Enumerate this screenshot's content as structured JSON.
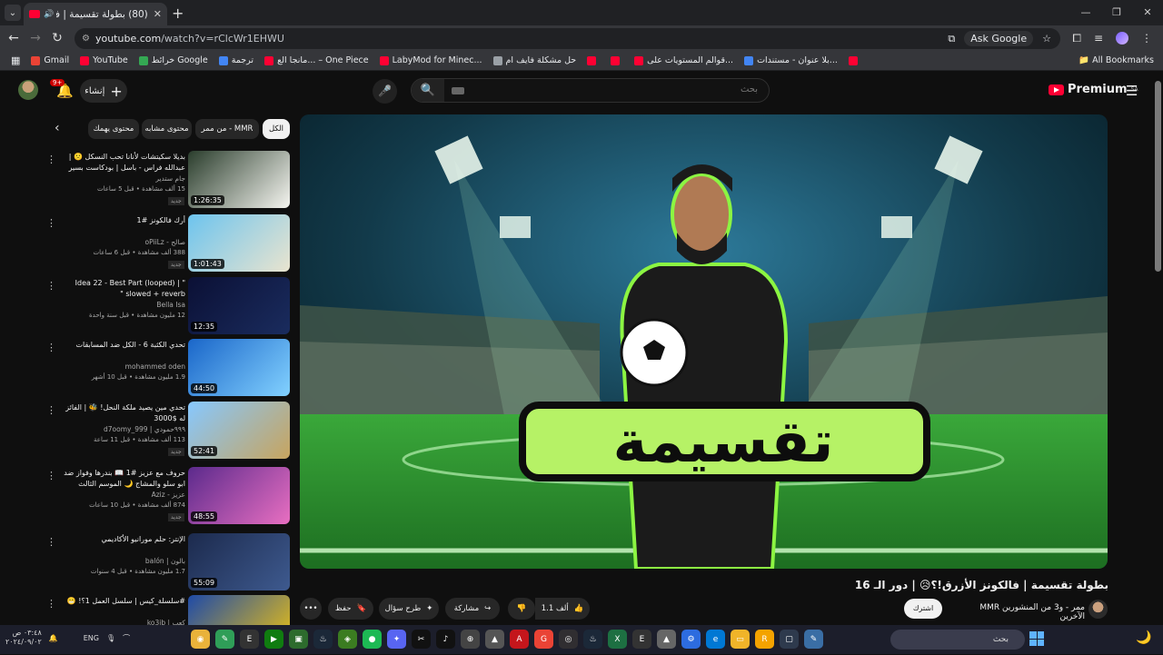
{
  "browser": {
    "tab_title": "(80) بطولة تقسيمة | فالكونز الأ...",
    "url_host": "youtube.com",
    "url_path": "/watch?v=rClcWr1EHWU",
    "ask_google": "Ask Google",
    "bookmarks": [
      {
        "label": "Gmail",
        "color": "#ea4335"
      },
      {
        "label": "YouTube",
        "color": "#ff0033"
      },
      {
        "label": "خرائط Google",
        "color": "#34a853"
      },
      {
        "label": "ترجمة",
        "color": "#4285f4"
      },
      {
        "label": "مانجا الع... – One Piece",
        "color": "#ff0033"
      },
      {
        "label": "LabyMod for Minec...",
        "color": "#ff0033"
      },
      {
        "label": "حل مشكلة فايف ام",
        "color": "#9aa0a6"
      },
      {
        "label": "",
        "color": "#ff0033"
      },
      {
        "label": "",
        "color": "#ff0033"
      },
      {
        "label": "قوالم المستويات على...",
        "color": "#ff0033"
      },
      {
        "label": "بلا عنوان - مستندات...",
        "color": "#4285f4"
      },
      {
        "label": "",
        "color": "#ff0033"
      }
    ],
    "all_bookmarks": "All Bookmarks"
  },
  "header": {
    "create_label": "إنشاء",
    "notif_count": "9+",
    "search_placeholder": "بحث",
    "logo_text": "Premium",
    "logo_region": "SA"
  },
  "chips": [
    {
      "label": "الكل",
      "active": true
    },
    {
      "label": "من ممر - MMR",
      "active": false
    },
    {
      "label": "محتوى مشابه",
      "active": false
    },
    {
      "label": "محتوى يهمك",
      "active": false
    }
  ],
  "recommendations": [
    {
      "title": "بديلا سكيتشات لأنانا تحب النسكل 🙁 | عبدالله فراس - باسل | بودكاست بسير خير",
      "channel": "جام ستدير",
      "meta": "15 ألف مشاهدة • قبل 5 ساعات",
      "badge": "جديد",
      "duration": "1:26:35",
      "colors": [
        "#2a3d2c",
        "#f5f5f0"
      ]
    },
    {
      "title": "أرك فالكونز #1",
      "channel": "oPiiLz - صالح",
      "meta": "388 ألف مشاهدة • قبل 6 ساعات",
      "badge": "جديد",
      "duration": "1:01:43",
      "colors": [
        "#6dc4ee",
        "#e9e4cf"
      ]
    },
    {
      "title": "Idea 22 - Best Part (looped) | \" slowed + reverb \"",
      "channel": "Bella Isa",
      "meta": "12 مليون مشاهدة • قبل سنة واحدة",
      "badge": "",
      "duration": "12:35",
      "colors": [
        "#0b1035",
        "#1a2c5e"
      ]
    },
    {
      "title": "تحدي الكثبة 6 - الكل ضد المسابقات",
      "channel": "mohammed oden",
      "meta": "1.9 مليون مشاهدة • قبل 10 أشهر",
      "badge": "",
      "duration": "44:50",
      "colors": [
        "#1a66c9",
        "#82d1ff"
      ]
    },
    {
      "title": "تحدي مين يصيد ملكة النحل! 🐝 | الفائز له $3000",
      "channel": "d7oomy_999 | ٩٩٩حمودي",
      "meta": "113 ألف مشاهدة • قبل 11 ساعة",
      "badge": "جديد",
      "duration": "52:41",
      "colors": [
        "#87c8ff",
        "#c7a45e"
      ]
    },
    {
      "title": "حروف مع عزيز #1 📖 بندرها وفواز ضد ابو سلو والمشاج 🌙 الموسم الثالث",
      "channel": "Aziz - عزيز",
      "meta": "874 ألف مشاهدة • قبل 10 ساعات",
      "badge": "جديد",
      "duration": "48:55",
      "colors": [
        "#5b2a8c",
        "#e86fc1"
      ]
    },
    {
      "title": "الإنتر: حلم مورانيو الأكاديمي",
      "channel": "balón | بالون",
      "meta": "1.7 مليون مشاهدة • قبل 4 سنوات",
      "badge": "",
      "duration": "55:09",
      "colors": [
        "#1c2a4d",
        "#3e5a8f"
      ]
    },
    {
      "title": "#سلسلة_كيس | سلسل العمل 1؟! 😬",
      "channel": "ko3ib | كعب",
      "meta": "316 ألف مشاهدة",
      "badge": "",
      "duration": "",
      "colors": [
        "#1e4aa8",
        "#f1c40f"
      ]
    }
  ],
  "video": {
    "title": "بطولة تقسيمة | فالكونز الأزرق!؟😥 | دور الـ 16",
    "channel": "MMR ممر - و3 من المنشورين الآخرين",
    "subscribe_label": "اشترك",
    "like_count": "1.1 ألف",
    "share_label": "مشاركة",
    "ask_label": "طرح سؤال",
    "save_label": "حفظ",
    "thumb_text": "تقسيمة"
  },
  "taskbar": {
    "time": "٠٣:٤٨ ص",
    "date": "٢٠٢٤/٠٩/٠٢",
    "lang": "ENG",
    "search_placeholder": "بحث",
    "icons": [
      {
        "name": "chrome-icon",
        "color": "#e9b23a"
      },
      {
        "name": "pen-icon",
        "color": "#2f9e58"
      },
      {
        "name": "epic-icon",
        "color": "#333"
      },
      {
        "name": "xbox-icon",
        "color": "#107c10"
      },
      {
        "name": "terminal-icon",
        "color": "#2d6b2d"
      },
      {
        "name": "steam-icon",
        "color": "#1b2838"
      },
      {
        "name": "nvidia-icon",
        "color": "#3b7c21"
      },
      {
        "name": "spotify-icon",
        "color": "#1db954"
      },
      {
        "name": "discord-icon",
        "color": "#5865f2"
      },
      {
        "name": "capcut-icon",
        "color": "#111"
      },
      {
        "name": "tiktok-icon",
        "color": "#111"
      },
      {
        "name": "controller-icon",
        "color": "#444"
      },
      {
        "name": "roblox-icon",
        "color": "#555"
      },
      {
        "name": "adobe-icon",
        "color": "#c4161c"
      },
      {
        "name": "google-icon",
        "color": "#ea4335"
      },
      {
        "name": "obs-icon",
        "color": "#302e31"
      },
      {
        "name": "steam2-icon",
        "color": "#1b2838"
      },
      {
        "name": "excel-icon",
        "color": "#1d6f42"
      },
      {
        "name": "epic2-icon",
        "color": "#333"
      },
      {
        "name": "launcher-icon",
        "color": "#666"
      },
      {
        "name": "settings-icon",
        "color": "#2d6cdf"
      },
      {
        "name": "edge-icon",
        "color": "#0078d4"
      },
      {
        "name": "folder-icon",
        "color": "#f0b429"
      },
      {
        "name": "rockstar-icon",
        "color": "#f4a300"
      },
      {
        "name": "window-icon",
        "color": "#2e3a4d"
      },
      {
        "name": "notepad-icon",
        "color": "#3a6ea5"
      }
    ]
  }
}
